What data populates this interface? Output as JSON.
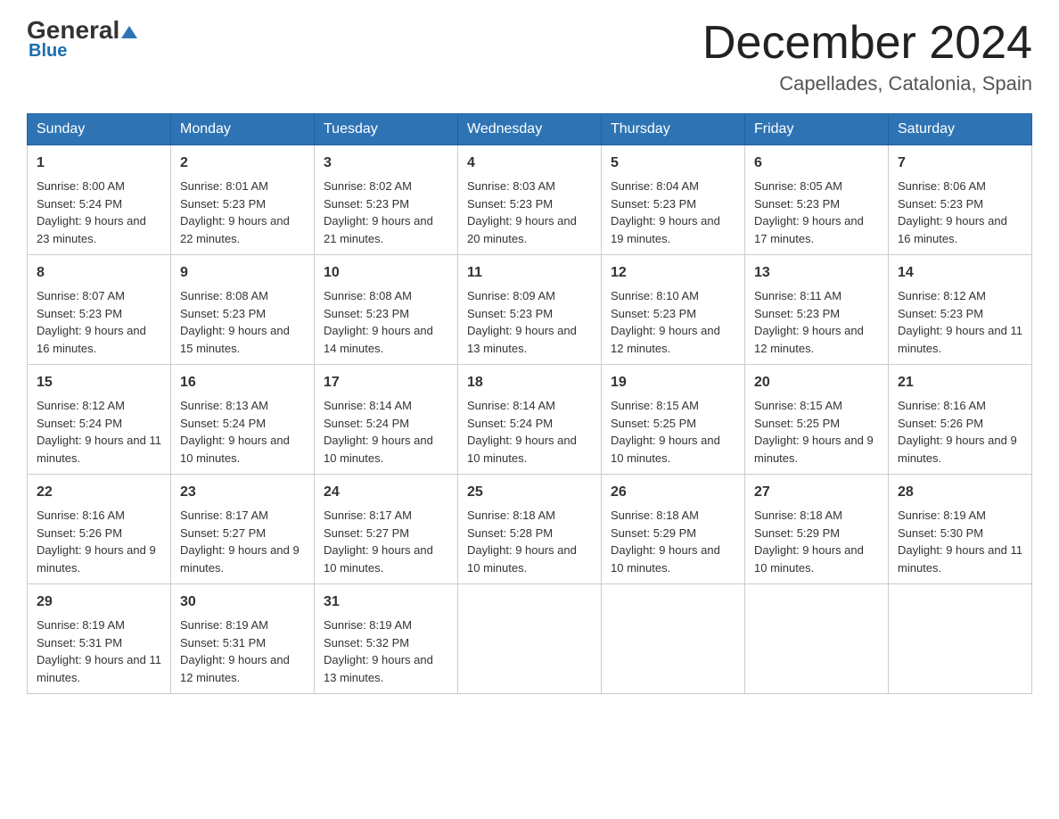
{
  "header": {
    "logo_general": "General",
    "logo_blue": "Blue",
    "month_title": "December 2024",
    "location": "Capellades, Catalonia, Spain"
  },
  "days_of_week": [
    "Sunday",
    "Monday",
    "Tuesday",
    "Wednesday",
    "Thursday",
    "Friday",
    "Saturday"
  ],
  "weeks": [
    [
      {
        "day": "1",
        "sunrise": "8:00 AM",
        "sunset": "5:24 PM",
        "daylight": "9 hours and 23 minutes."
      },
      {
        "day": "2",
        "sunrise": "8:01 AM",
        "sunset": "5:23 PM",
        "daylight": "9 hours and 22 minutes."
      },
      {
        "day": "3",
        "sunrise": "8:02 AM",
        "sunset": "5:23 PM",
        "daylight": "9 hours and 21 minutes."
      },
      {
        "day": "4",
        "sunrise": "8:03 AM",
        "sunset": "5:23 PM",
        "daylight": "9 hours and 20 minutes."
      },
      {
        "day": "5",
        "sunrise": "8:04 AM",
        "sunset": "5:23 PM",
        "daylight": "9 hours and 19 minutes."
      },
      {
        "day": "6",
        "sunrise": "8:05 AM",
        "sunset": "5:23 PM",
        "daylight": "9 hours and 17 minutes."
      },
      {
        "day": "7",
        "sunrise": "8:06 AM",
        "sunset": "5:23 PM",
        "daylight": "9 hours and 16 minutes."
      }
    ],
    [
      {
        "day": "8",
        "sunrise": "8:07 AM",
        "sunset": "5:23 PM",
        "daylight": "9 hours and 16 minutes."
      },
      {
        "day": "9",
        "sunrise": "8:08 AM",
        "sunset": "5:23 PM",
        "daylight": "9 hours and 15 minutes."
      },
      {
        "day": "10",
        "sunrise": "8:08 AM",
        "sunset": "5:23 PM",
        "daylight": "9 hours and 14 minutes."
      },
      {
        "day": "11",
        "sunrise": "8:09 AM",
        "sunset": "5:23 PM",
        "daylight": "9 hours and 13 minutes."
      },
      {
        "day": "12",
        "sunrise": "8:10 AM",
        "sunset": "5:23 PM",
        "daylight": "9 hours and 12 minutes."
      },
      {
        "day": "13",
        "sunrise": "8:11 AM",
        "sunset": "5:23 PM",
        "daylight": "9 hours and 12 minutes."
      },
      {
        "day": "14",
        "sunrise": "8:12 AM",
        "sunset": "5:23 PM",
        "daylight": "9 hours and 11 minutes."
      }
    ],
    [
      {
        "day": "15",
        "sunrise": "8:12 AM",
        "sunset": "5:24 PM",
        "daylight": "9 hours and 11 minutes."
      },
      {
        "day": "16",
        "sunrise": "8:13 AM",
        "sunset": "5:24 PM",
        "daylight": "9 hours and 10 minutes."
      },
      {
        "day": "17",
        "sunrise": "8:14 AM",
        "sunset": "5:24 PM",
        "daylight": "9 hours and 10 minutes."
      },
      {
        "day": "18",
        "sunrise": "8:14 AM",
        "sunset": "5:24 PM",
        "daylight": "9 hours and 10 minutes."
      },
      {
        "day": "19",
        "sunrise": "8:15 AM",
        "sunset": "5:25 PM",
        "daylight": "9 hours and 10 minutes."
      },
      {
        "day": "20",
        "sunrise": "8:15 AM",
        "sunset": "5:25 PM",
        "daylight": "9 hours and 9 minutes."
      },
      {
        "day": "21",
        "sunrise": "8:16 AM",
        "sunset": "5:26 PM",
        "daylight": "9 hours and 9 minutes."
      }
    ],
    [
      {
        "day": "22",
        "sunrise": "8:16 AM",
        "sunset": "5:26 PM",
        "daylight": "9 hours and 9 minutes."
      },
      {
        "day": "23",
        "sunrise": "8:17 AM",
        "sunset": "5:27 PM",
        "daylight": "9 hours and 9 minutes."
      },
      {
        "day": "24",
        "sunrise": "8:17 AM",
        "sunset": "5:27 PM",
        "daylight": "9 hours and 10 minutes."
      },
      {
        "day": "25",
        "sunrise": "8:18 AM",
        "sunset": "5:28 PM",
        "daylight": "9 hours and 10 minutes."
      },
      {
        "day": "26",
        "sunrise": "8:18 AM",
        "sunset": "5:29 PM",
        "daylight": "9 hours and 10 minutes."
      },
      {
        "day": "27",
        "sunrise": "8:18 AM",
        "sunset": "5:29 PM",
        "daylight": "9 hours and 10 minutes."
      },
      {
        "day": "28",
        "sunrise": "8:19 AM",
        "sunset": "5:30 PM",
        "daylight": "9 hours and 11 minutes."
      }
    ],
    [
      {
        "day": "29",
        "sunrise": "8:19 AM",
        "sunset": "5:31 PM",
        "daylight": "9 hours and 11 minutes."
      },
      {
        "day": "30",
        "sunrise": "8:19 AM",
        "sunset": "5:31 PM",
        "daylight": "9 hours and 12 minutes."
      },
      {
        "day": "31",
        "sunrise": "8:19 AM",
        "sunset": "5:32 PM",
        "daylight": "9 hours and 13 minutes."
      },
      null,
      null,
      null,
      null
    ]
  ]
}
